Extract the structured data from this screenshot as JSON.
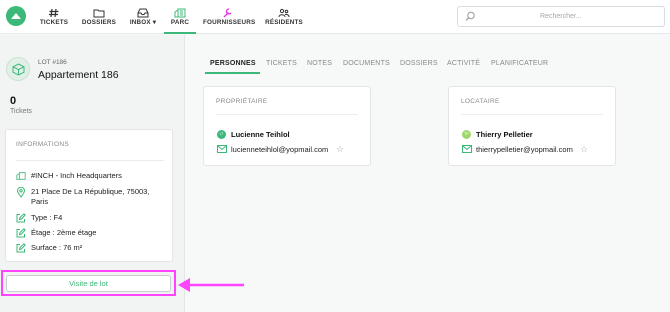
{
  "nav": {
    "items": [
      {
        "label": "TICKETS",
        "icon": "hash-icon"
      },
      {
        "label": "DOSSIERS",
        "icon": "folder-icon"
      },
      {
        "label": "INBOX",
        "icon": "inbox-icon"
      },
      {
        "label": "PARC",
        "icon": "building-icon"
      },
      {
        "label": "FOURNISSEURS",
        "icon": "wrench-icon"
      },
      {
        "label": "RÉSIDENTS",
        "icon": "people-icon"
      }
    ],
    "inbox_suffix": "▾",
    "active": "PARC",
    "search_placeholder": "Rechercher..."
  },
  "lot": {
    "id_label": "LOT #186",
    "title": "Appartement 186",
    "ticket_count": "0",
    "ticket_label": "Tickets"
  },
  "info": {
    "heading": "INFORMATIONS",
    "rows": [
      {
        "icon": "building-icon",
        "text": "#INCH - Inch Headquarters"
      },
      {
        "icon": "location-pin-icon",
        "text": "21 Place De La République, 75003, Paris"
      },
      {
        "icon": "edit-icon",
        "text": "Type : F4"
      },
      {
        "icon": "edit-icon",
        "text": "Étage : 2ème étage"
      },
      {
        "icon": "edit-icon",
        "text": "Surface : 76 m²"
      }
    ]
  },
  "visit_button": "Visite de lot",
  "tabs": [
    "PERSONNES",
    "TICKETS",
    "NOTES",
    "DOCUMENTS",
    "DOSSIERS",
    "ACTIVITÉ",
    "PLANIFICATEUR"
  ],
  "active_tab": "PERSONNES",
  "owner": {
    "heading": "PROPRIÉTAIRE",
    "initials": "LT",
    "name": "Lucienne Teihlol",
    "email": "lucienneteihlol@yopmail.com"
  },
  "tenant": {
    "heading": "LOCATAIRE",
    "initials": "TP",
    "name": "Thierry Pelletier",
    "email": "thierrypelletier@yopmail.com"
  },
  "colors": {
    "accent": "#3cb878",
    "highlight": "#ff44ff"
  }
}
